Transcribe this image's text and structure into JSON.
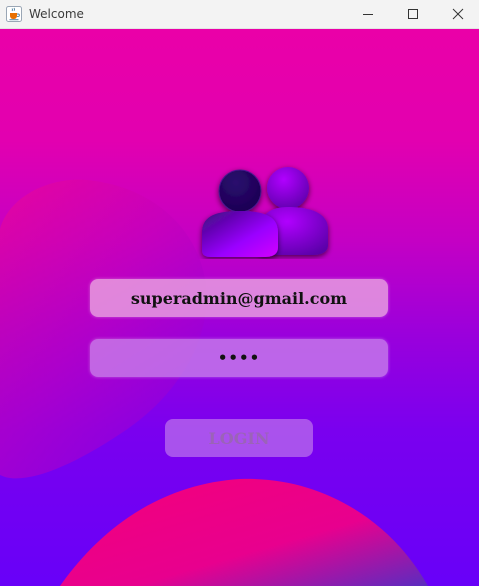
{
  "window": {
    "title": "Welcome"
  },
  "icons": {
    "app": "java-coffee-cup-icon",
    "minimize": "minimize-icon",
    "maximize": "maximize-icon",
    "close": "close-icon",
    "users": "users-group-icon"
  },
  "form": {
    "email_value": "superadmin@gmail.com",
    "password_mask": "••••",
    "login_label": "LOGIN"
  },
  "colors": {
    "background_top": "#ea00a8",
    "background_bottom": "#6800f8",
    "blob": "#ee0a8c"
  }
}
